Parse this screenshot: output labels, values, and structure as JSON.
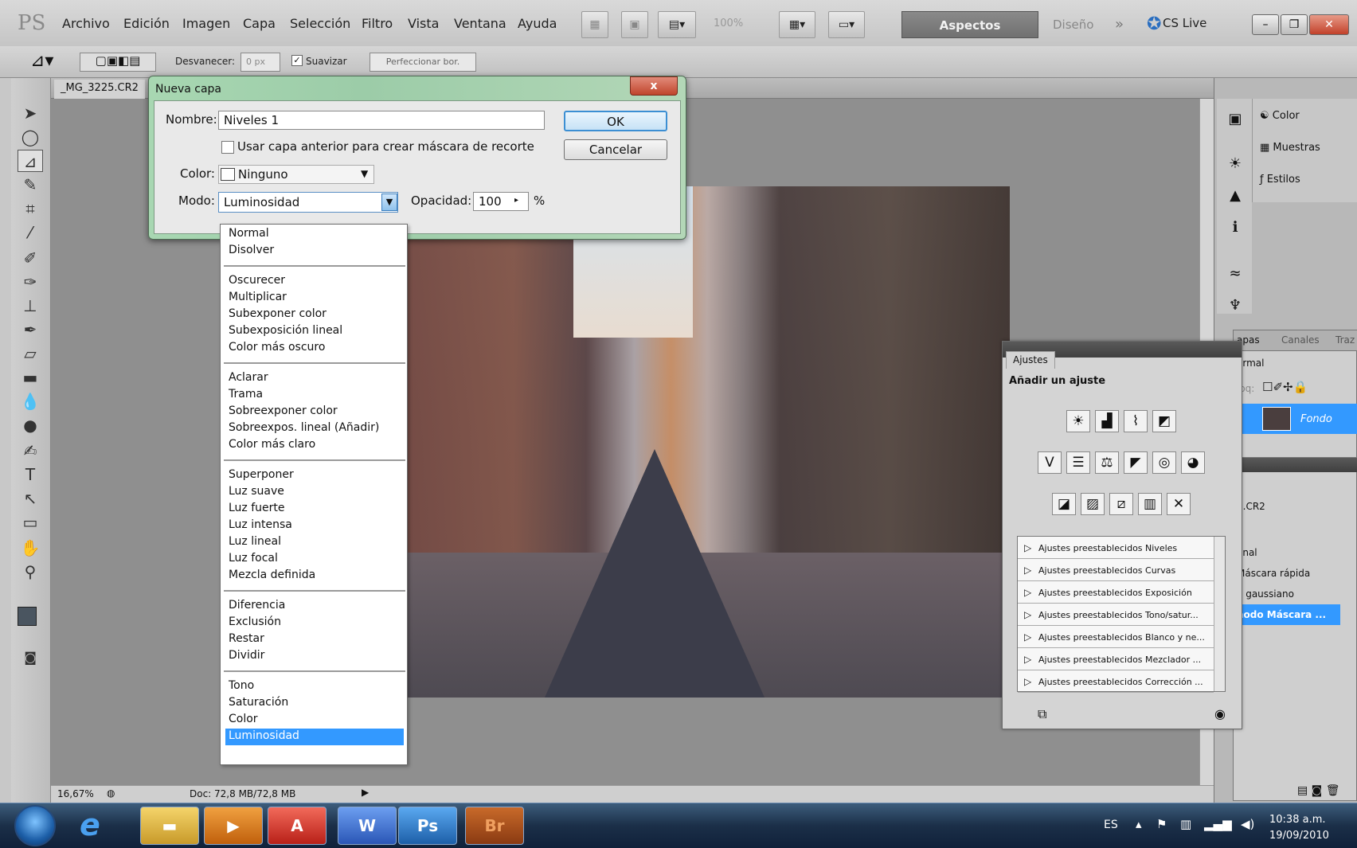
{
  "app": {
    "logo": "PS"
  },
  "menu": [
    "Archivo",
    "Edición",
    "Imagen",
    "Capa",
    "Selección",
    "Filtro",
    "Vista",
    "Ventana",
    "Ayuda"
  ],
  "toolbar_top": {
    "zoom": "100%",
    "workspace_active": "Aspectos esenciales",
    "workspace_other": "Diseño",
    "more": "»",
    "cslive": "CS Live"
  },
  "options": {
    "feather_label": "Desvanecer:",
    "feather_value": "0 px",
    "smooth_label": "Suavizar",
    "refine_button": "Perfeccionar bor."
  },
  "document": {
    "tab": "_MG_3225.CR2",
    "zoom": "16,67%",
    "doc_info": "Doc: 72,8 MB/72,8 MB"
  },
  "dialog": {
    "title": "Nueva capa",
    "close": "x",
    "name_label": "Nombre:",
    "name_value": "Niveles 1",
    "clip_label": "Usar capa anterior para crear máscara de recorte",
    "color_label": "Color:",
    "color_value": "Ninguno",
    "mode_label": "Modo:",
    "mode_value": "Luminosidad",
    "opacity_label": "Opacidad:",
    "opacity_value": "100",
    "opacity_unit": "%",
    "ok": "OK",
    "cancel": "Cancelar"
  },
  "blend_modes": [
    [
      "Normal",
      "Disolver"
    ],
    [
      "Oscurecer",
      "Multiplicar",
      "Subexponer color",
      "Subexposición lineal",
      "Color más oscuro"
    ],
    [
      "Aclarar",
      "Trama",
      "Sobreexponer color",
      "Sobreexpos. lineal (Añadir)",
      "Color más claro"
    ],
    [
      "Superponer",
      "Luz suave",
      "Luz fuerte",
      "Luz intensa",
      "Luz lineal",
      "Luz focal",
      "Mezcla definida"
    ],
    [
      "Diferencia",
      "Exclusión",
      "Restar",
      "Dividir"
    ],
    [
      "Tono",
      "Saturación",
      "Color",
      "Luminosidad"
    ]
  ],
  "blend_selected": "Luminosidad",
  "right_panel": {
    "items": [
      "Color",
      "Muestras",
      "Estilos"
    ]
  },
  "ajustes": {
    "tab": "Ajustes",
    "heading": "Añadir un ajuste",
    "presets": [
      "Ajustes preestablecidos Niveles",
      "Ajustes preestablecidos Curvas",
      "Ajustes preestablecidos Exposición",
      "Ajustes preestablecidos Tono/satur...",
      "Ajustes preestablecidos Blanco y ne...",
      "Ajustes preestablecidos Mezclador ...",
      "Ajustes preestablecidos Corrección ..."
    ]
  },
  "layers": {
    "tabs": [
      "apas",
      "Canales",
      "Traz"
    ],
    "blend": "ormal",
    "lock_label": "loq:",
    "layer_name": "Fondo"
  },
  "history": {
    "doc": "5.CR2",
    "items": [
      "onal",
      "Máscara rápida",
      "e gaussiano",
      "nodo Máscara ..."
    ]
  },
  "taskbar": {
    "lang": "ES",
    "time": "10:38 a.m.",
    "date": "19/09/2010",
    "apps": [
      "Ps",
      "Br"
    ]
  },
  "colors": {
    "selection": "#3399ff",
    "dialog_frame": "#a8d7b2",
    "workspace_active": "#707070"
  }
}
